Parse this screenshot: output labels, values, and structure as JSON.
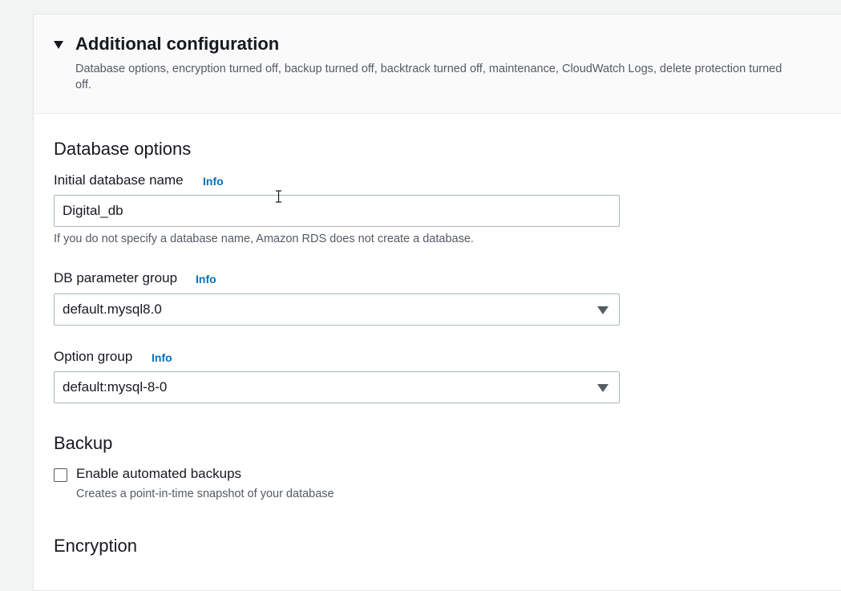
{
  "additional_config": {
    "title": "Additional configuration",
    "description": "Database options, encryption turned off, backup turned off, backtrack turned off, maintenance, CloudWatch Logs, delete protection turned off."
  },
  "database_options": {
    "title": "Database options",
    "initial_db_name": {
      "label": "Initial database name",
      "info": "Info",
      "value": "Digital_db",
      "hint": "If you do not specify a database name, Amazon RDS does not create a database."
    },
    "parameter_group": {
      "label": "DB parameter group",
      "info": "Info",
      "selected": "default.mysql8.0"
    },
    "option_group": {
      "label": "Option group",
      "info": "Info",
      "selected": "default:mysql-8-0"
    }
  },
  "backup": {
    "title": "Backup",
    "enable_automated": {
      "label": "Enable automated backups",
      "description": "Creates a point-in-time snapshot of your database",
      "checked": false
    }
  },
  "encryption": {
    "title": "Encryption"
  },
  "icons": {
    "expand": "caret-down-icon",
    "select_arrow": "triangle-down-icon",
    "cursor": "text-cursor-icon"
  },
  "colors": {
    "info_link": "#0073bb",
    "text_primary": "#16191f",
    "text_secondary": "#545b64",
    "border": "#aab7b8"
  }
}
